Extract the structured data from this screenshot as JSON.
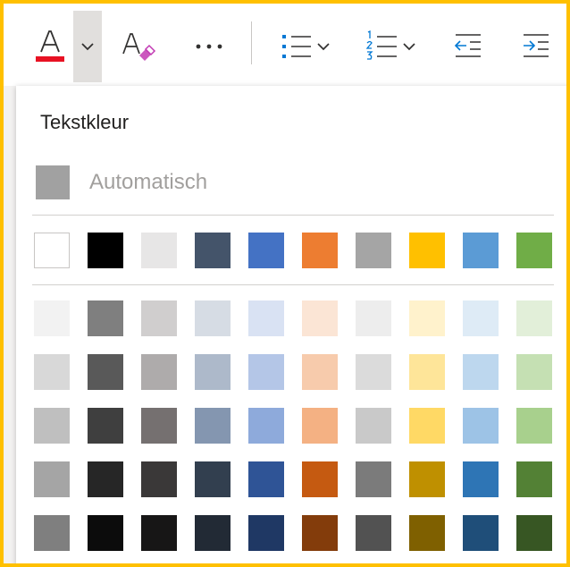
{
  "popup": {
    "title": "Tekstkleur",
    "automatic_label": "Automatisch",
    "automatic_color": "#a1a1a1"
  },
  "colors": {
    "frame_accent": "#ffc000",
    "font_color_underline": "#e81123"
  },
  "toolbar": {
    "items": [
      {
        "name": "font-color-button",
        "icon": "font-color-icon"
      },
      {
        "name": "font-color-dropdown",
        "icon": "chevron-down-icon",
        "selected": true
      },
      {
        "name": "clear-formatting-button",
        "icon": "clear-formatting-icon"
      },
      {
        "name": "more-options-button",
        "icon": "ellipsis-icon"
      },
      {
        "name": "bullets-button",
        "icon": "bulleted-list-icon"
      },
      {
        "name": "numbering-button",
        "icon": "numbered-list-icon"
      },
      {
        "name": "decrease-indent-button",
        "icon": "decrease-indent-icon"
      },
      {
        "name": "increase-indent-button",
        "icon": "increase-indent-icon"
      }
    ]
  },
  "theme_colors": [
    "#ffffff",
    "#000000",
    "#e7e6e6",
    "#44546a",
    "#4472c4",
    "#ed7d31",
    "#a5a5a5",
    "#ffc000",
    "#5b9bd5",
    "#70ad47"
  ],
  "shades": [
    [
      "#f2f2f2",
      "#7f7f7f",
      "#d0cece",
      "#d6dce4",
      "#d9e2f3",
      "#fbe5d5",
      "#ededed",
      "#fff2cc",
      "#deebf6",
      "#e2efd9"
    ],
    [
      "#d8d8d8",
      "#595959",
      "#aeabab",
      "#adb9ca",
      "#b4c6e7",
      "#f7cbac",
      "#dbdbdb",
      "#fee599",
      "#bdd7ee",
      "#c5e0b3"
    ],
    [
      "#bfbfbf",
      "#3f3f3f",
      "#757070",
      "#8496b0",
      "#8eaadb",
      "#f4b183",
      "#c9c9c9",
      "#ffd965",
      "#9dc3e6",
      "#a8d08d"
    ],
    [
      "#a5a5a5",
      "#262626",
      "#3a3838",
      "#323f4f",
      "#2f5496",
      "#c55a11",
      "#7b7b7b",
      "#bf9000",
      "#2e75b5",
      "#538135"
    ],
    [
      "#7f7f7f",
      "#0c0c0c",
      "#171616",
      "#222a35",
      "#1f3864",
      "#833c0b",
      "#525252",
      "#7f6000",
      "#1f4e79",
      "#375623"
    ]
  ]
}
